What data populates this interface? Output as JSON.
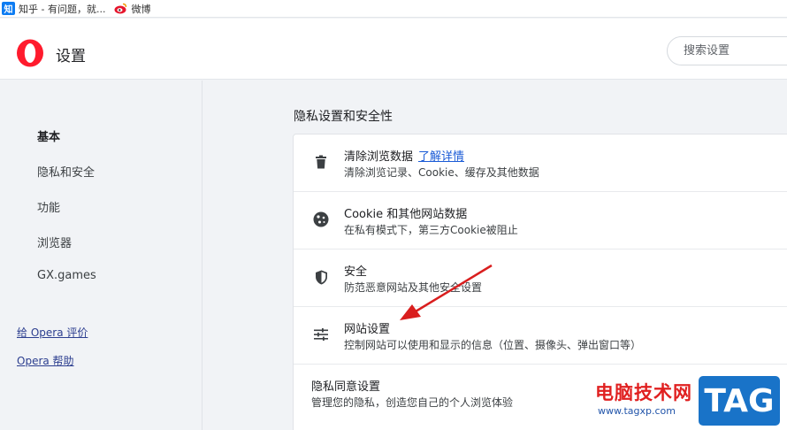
{
  "bookmarks": [
    {
      "icon": "zhihu-icon",
      "label": "知乎 - 有问题，就..."
    },
    {
      "icon": "weibo-icon",
      "label": "微博"
    }
  ],
  "header": {
    "title": "设置",
    "search_placeholder": "搜索设置"
  },
  "sidebar": {
    "items": [
      {
        "label": "基本",
        "active": true
      },
      {
        "label": "隐私和安全"
      },
      {
        "label": "功能"
      },
      {
        "label": "浏览器"
      },
      {
        "label": "GX.games"
      }
    ],
    "links": [
      {
        "label": "给 Opera 评价"
      },
      {
        "label": "Opera 帮助"
      }
    ]
  },
  "main": {
    "section_title": "隐私设置和安全性",
    "rows": [
      {
        "icon": "trash-icon",
        "title": "清除浏览数据",
        "link": "了解详情",
        "subtitle": "清除浏览记录、Cookie、缓存及其他数据"
      },
      {
        "icon": "cookie-icon",
        "title": "Cookie 和其他网站数据",
        "subtitle": "在私有模式下，第三方Cookie被阻止"
      },
      {
        "icon": "shield-icon",
        "title": "安全",
        "subtitle": "防范恶意网站及其他安全设置"
      },
      {
        "icon": "sliders-icon",
        "title": "网站设置",
        "subtitle": "控制网站可以使用和显示的信息（位置、摄像头、弹出窗口等）"
      },
      {
        "title": "隐私同意设置",
        "subtitle": "管理您的隐私，创造您自己的个人浏览体验"
      }
    ]
  },
  "watermark": {
    "site_name": "电脑技术网",
    "url": "www.tagxp.com",
    "tag": "TAG"
  },
  "colors": {
    "accent_red": "#e02020",
    "link_blue": "#1a5bd6",
    "opera_red": "#ff1b2d"
  }
}
